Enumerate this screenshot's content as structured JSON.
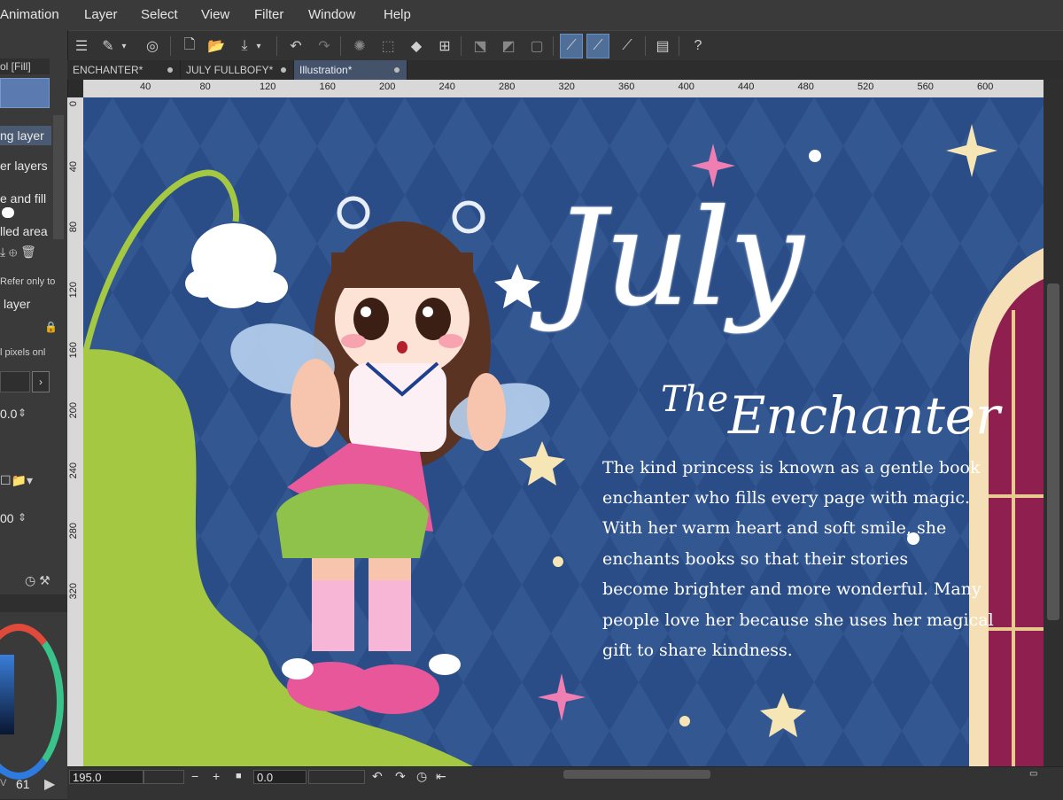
{
  "menu": [
    "Animation",
    "Layer",
    "Select",
    "View",
    "Filter",
    "Window",
    "Help"
  ],
  "tabs": [
    {
      "label": "ENCHANTER*"
    },
    {
      "label": "JULY FULLBOFY*"
    },
    {
      "label": "Illustration*"
    }
  ],
  "left_panel": {
    "tool_title": "ol [Fill]",
    "options": [
      "ng layer",
      "er layers",
      "e and fill",
      "lled area"
    ],
    "refer_label": "Refer only to",
    "layer_label": "layer",
    "pixels_label": "l pixels onl",
    "value1": "0.0",
    "value2": "00",
    "color_value": "61",
    "color_mode": "V"
  },
  "ruler_ticks": [
    "40",
    "80",
    "120",
    "160",
    "200",
    "240",
    "280",
    "320",
    "360",
    "400",
    "440",
    "480",
    "520",
    "560",
    "600"
  ],
  "ruler_left_ticks": [
    "0",
    "40",
    "80",
    "120",
    "160",
    "200",
    "240",
    "280",
    "320"
  ],
  "canvas": {
    "title": "July",
    "subtitle_the": "The",
    "subtitle_main": "Enchanter",
    "body": [
      "The kind princess is known as a gentle book",
      "enchanter who fills every page with magic.",
      "With her warm heart and soft smile, she",
      "enchants books so that their stories",
      "become brighter and more wonderful. Many",
      "people love her because she uses her magical",
      "gift to share kindness."
    ]
  },
  "status": {
    "zoom": "195.0",
    "rotation": "0.0"
  },
  "colors": {
    "canvas_bg": "#2a4d87",
    "grass": "#a5c843",
    "accent_active": "#4f6f99"
  }
}
